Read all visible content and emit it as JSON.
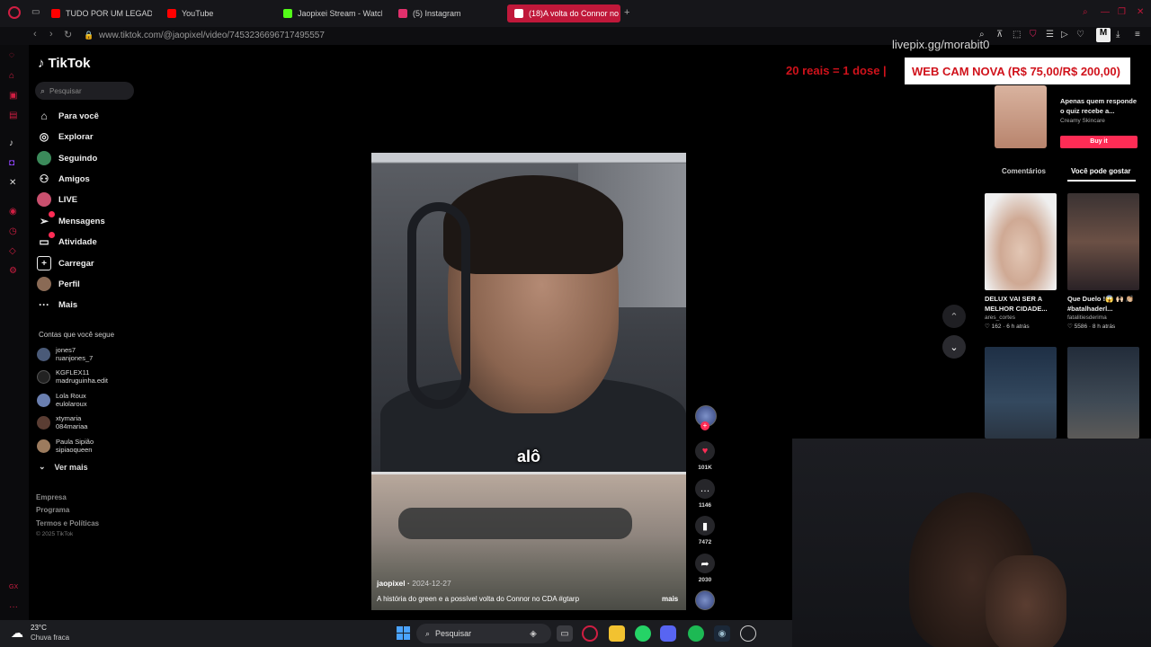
{
  "browser": {
    "tabs": [
      {
        "label": "TUDO POR UM LEGADO,",
        "icon": "youtube-icon",
        "color": "#ff0000"
      },
      {
        "label": "YouTube",
        "icon": "youtube-icon",
        "color": "#ff0000"
      },
      {
        "label": "Jaopixei Stream - Watch",
        "icon": "kick-icon",
        "color": "#53fc18"
      },
      {
        "label": "(5) Instagram",
        "icon": "instagram-icon",
        "color": "#e1306c"
      },
      {
        "label": "(18)A volta do Connor no",
        "icon": "tiktok-icon",
        "color": "#ffffff",
        "active": true
      }
    ],
    "url": "www.tiktok.com/@jaopixel/video/7453236696717495557"
  },
  "tiktok": {
    "logo": "TikTok",
    "search_placeholder": "Pesquisar",
    "nav": [
      {
        "label": "Para você",
        "icon": "home-icon"
      },
      {
        "label": "Explorar",
        "icon": "compass-icon"
      },
      {
        "label": "Seguindo",
        "icon": "following-icon"
      },
      {
        "label": "Amigos",
        "icon": "friends-icon"
      },
      {
        "label": "LIVE",
        "icon": "live-icon"
      },
      {
        "label": "Mensagens",
        "icon": "messages-icon",
        "badge": true
      },
      {
        "label": "Atividade",
        "icon": "activity-icon",
        "badge": true
      },
      {
        "label": "Carregar",
        "icon": "upload-icon"
      },
      {
        "label": "Perfil",
        "icon": "profile-icon"
      },
      {
        "label": "Mais",
        "icon": "more-icon"
      }
    ],
    "following_header": "Contas que você segue",
    "following": [
      {
        "name": "jones7",
        "handle": "ruanjones_7"
      },
      {
        "name": "KGFLEX11",
        "handle": "madruguinha.edit"
      },
      {
        "name": "Lola Roux",
        "handle": "eulolaroux"
      },
      {
        "name": "xtymaria",
        "handle": "084mariaa"
      },
      {
        "name": "Paula Sipião",
        "handle": "sipiaoqueen"
      }
    ],
    "see_more": "Ver mais",
    "footer": [
      "Empresa",
      "Programa",
      "Termos e Políticas"
    ],
    "copyright": "© 2025 TikTok",
    "video": {
      "caption_word": "alô",
      "author": "jaopixel",
      "date": "2024-12-27",
      "description": "A história do green e a possível volta do Connor no CDA #gtarp",
      "more": "mais"
    },
    "actions": {
      "likes": "101K",
      "comments": "1146",
      "saves": "7472",
      "shares": "2030"
    },
    "ad": {
      "text": "Apenas quem responde o quiz recebe a...",
      "brand": "Creamy Skincare",
      "button": "Buy it"
    },
    "right_tabs": {
      "comments": "Comentários",
      "you_may_like": "Você pode gostar"
    },
    "suggestions": [
      {
        "title": "DELUX VAI SER A MELHOR CIDADE...",
        "user": "ares_cortes",
        "likes": "162",
        "time": "6 h atrás"
      },
      {
        "title": "Que Duelo !😱 🙌🏻 👏🏼 #batalhaderl...",
        "user": "fatalitiesderima",
        "likes": "5586",
        "time": "8 h atrás"
      }
    ]
  },
  "overlay": {
    "livepix": "livepix.gg/morabit0",
    "donation_red": "20 reais = 1 dose |",
    "donation_box": "WEB CAM NOVA (R$ 75,00/R$ 200,00)"
  },
  "taskbar": {
    "temperature": "23°C",
    "weather": "Chuva fraca",
    "search": "Pesquisar"
  }
}
